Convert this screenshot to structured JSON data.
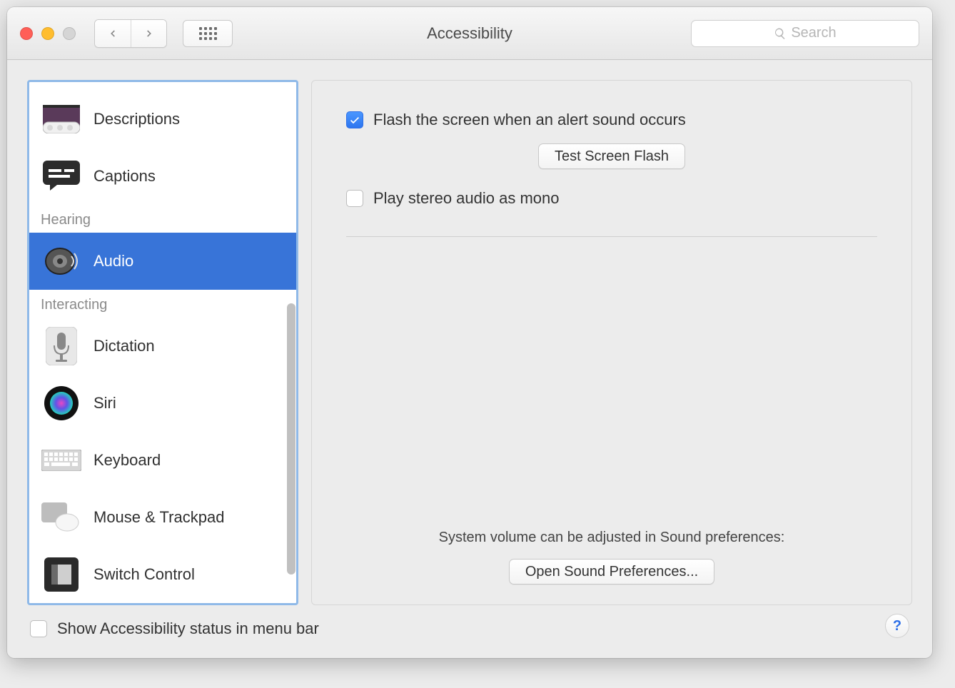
{
  "window": {
    "title": "Accessibility"
  },
  "toolbar": {
    "search_placeholder": "Search"
  },
  "sidebar": {
    "items": [
      {
        "label": "Descriptions",
        "icon": "descriptions-icon",
        "group": null
      },
      {
        "label": "Captions",
        "icon": "captions-icon",
        "group": null
      },
      {
        "group_header": "Hearing"
      },
      {
        "label": "Audio",
        "icon": "speaker-icon",
        "group": "Hearing",
        "selected": true
      },
      {
        "group_header": "Interacting"
      },
      {
        "label": "Dictation",
        "icon": "microphone-icon",
        "group": "Interacting"
      },
      {
        "label": "Siri",
        "icon": "siri-icon",
        "group": "Interacting"
      },
      {
        "label": "Keyboard",
        "icon": "keyboard-icon",
        "group": "Interacting"
      },
      {
        "label": "Mouse & Trackpad",
        "icon": "mouse-trackpad-icon",
        "group": "Interacting"
      },
      {
        "label": "Switch Control",
        "icon": "switch-control-icon",
        "group": "Interacting"
      }
    ]
  },
  "detail": {
    "flash_screen": {
      "checked": true,
      "label": "Flash the screen when an alert sound occurs"
    },
    "test_button": "Test Screen Flash",
    "mono_audio": {
      "checked": false,
      "label": "Play stereo audio as mono"
    },
    "footer_text": "System volume can be adjusted in Sound preferences:",
    "open_sound_button": "Open Sound Preferences..."
  },
  "bottom": {
    "show_status_label": "Show Accessibility status in menu bar",
    "show_status_checked": false,
    "help_label": "?"
  }
}
